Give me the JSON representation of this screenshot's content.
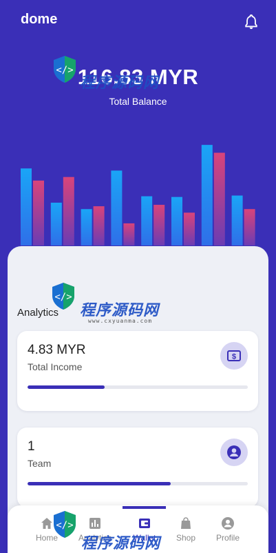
{
  "app": {
    "brand": "dome"
  },
  "balance": {
    "amount": "116.83 MYR",
    "label": "Total Balance"
  },
  "chart_data": {
    "type": "bar",
    "series": [
      {
        "values": [
          108,
          60,
          51,
          105,
          69,
          68,
          141,
          70
        ],
        "colors": [
          "#2f7ff0",
          "#1aa5f7"
        ]
      },
      {
        "values": [
          91,
          96,
          55,
          31,
          57,
          46,
          130,
          51
        ],
        "colors": [
          "#c8417d",
          "#7a3fb3"
        ]
      }
    ],
    "ylim": [
      0,
      145
    ],
    "grid": false
  },
  "analytics": {
    "title": "Analytics",
    "cards": [
      {
        "value": "4.83 MYR",
        "label": "Total Income",
        "icon": "dollar-bill-icon",
        "progress": 0.35
      },
      {
        "value": "1",
        "label": "Team",
        "icon": "person-icon",
        "progress": 0.65
      }
    ]
  },
  "nav": {
    "items": [
      {
        "label": "Home",
        "icon": "home-icon"
      },
      {
        "label": "Analytics",
        "icon": "analytics-icon"
      },
      {
        "label": "Wallet",
        "icon": "wallet-icon",
        "active": true
      },
      {
        "label": "Shop",
        "icon": "shop-bag-icon"
      },
      {
        "label": "Profile",
        "icon": "profile-icon"
      }
    ]
  },
  "watermark": {
    "text": "程序源码网",
    "url": "www.cxyuanma.com"
  },
  "colors": {
    "primary": "#3a2fb7",
    "sheet": "#eef0f6",
    "card": "#ffffff",
    "accent_soft": "#d6d4f3"
  }
}
